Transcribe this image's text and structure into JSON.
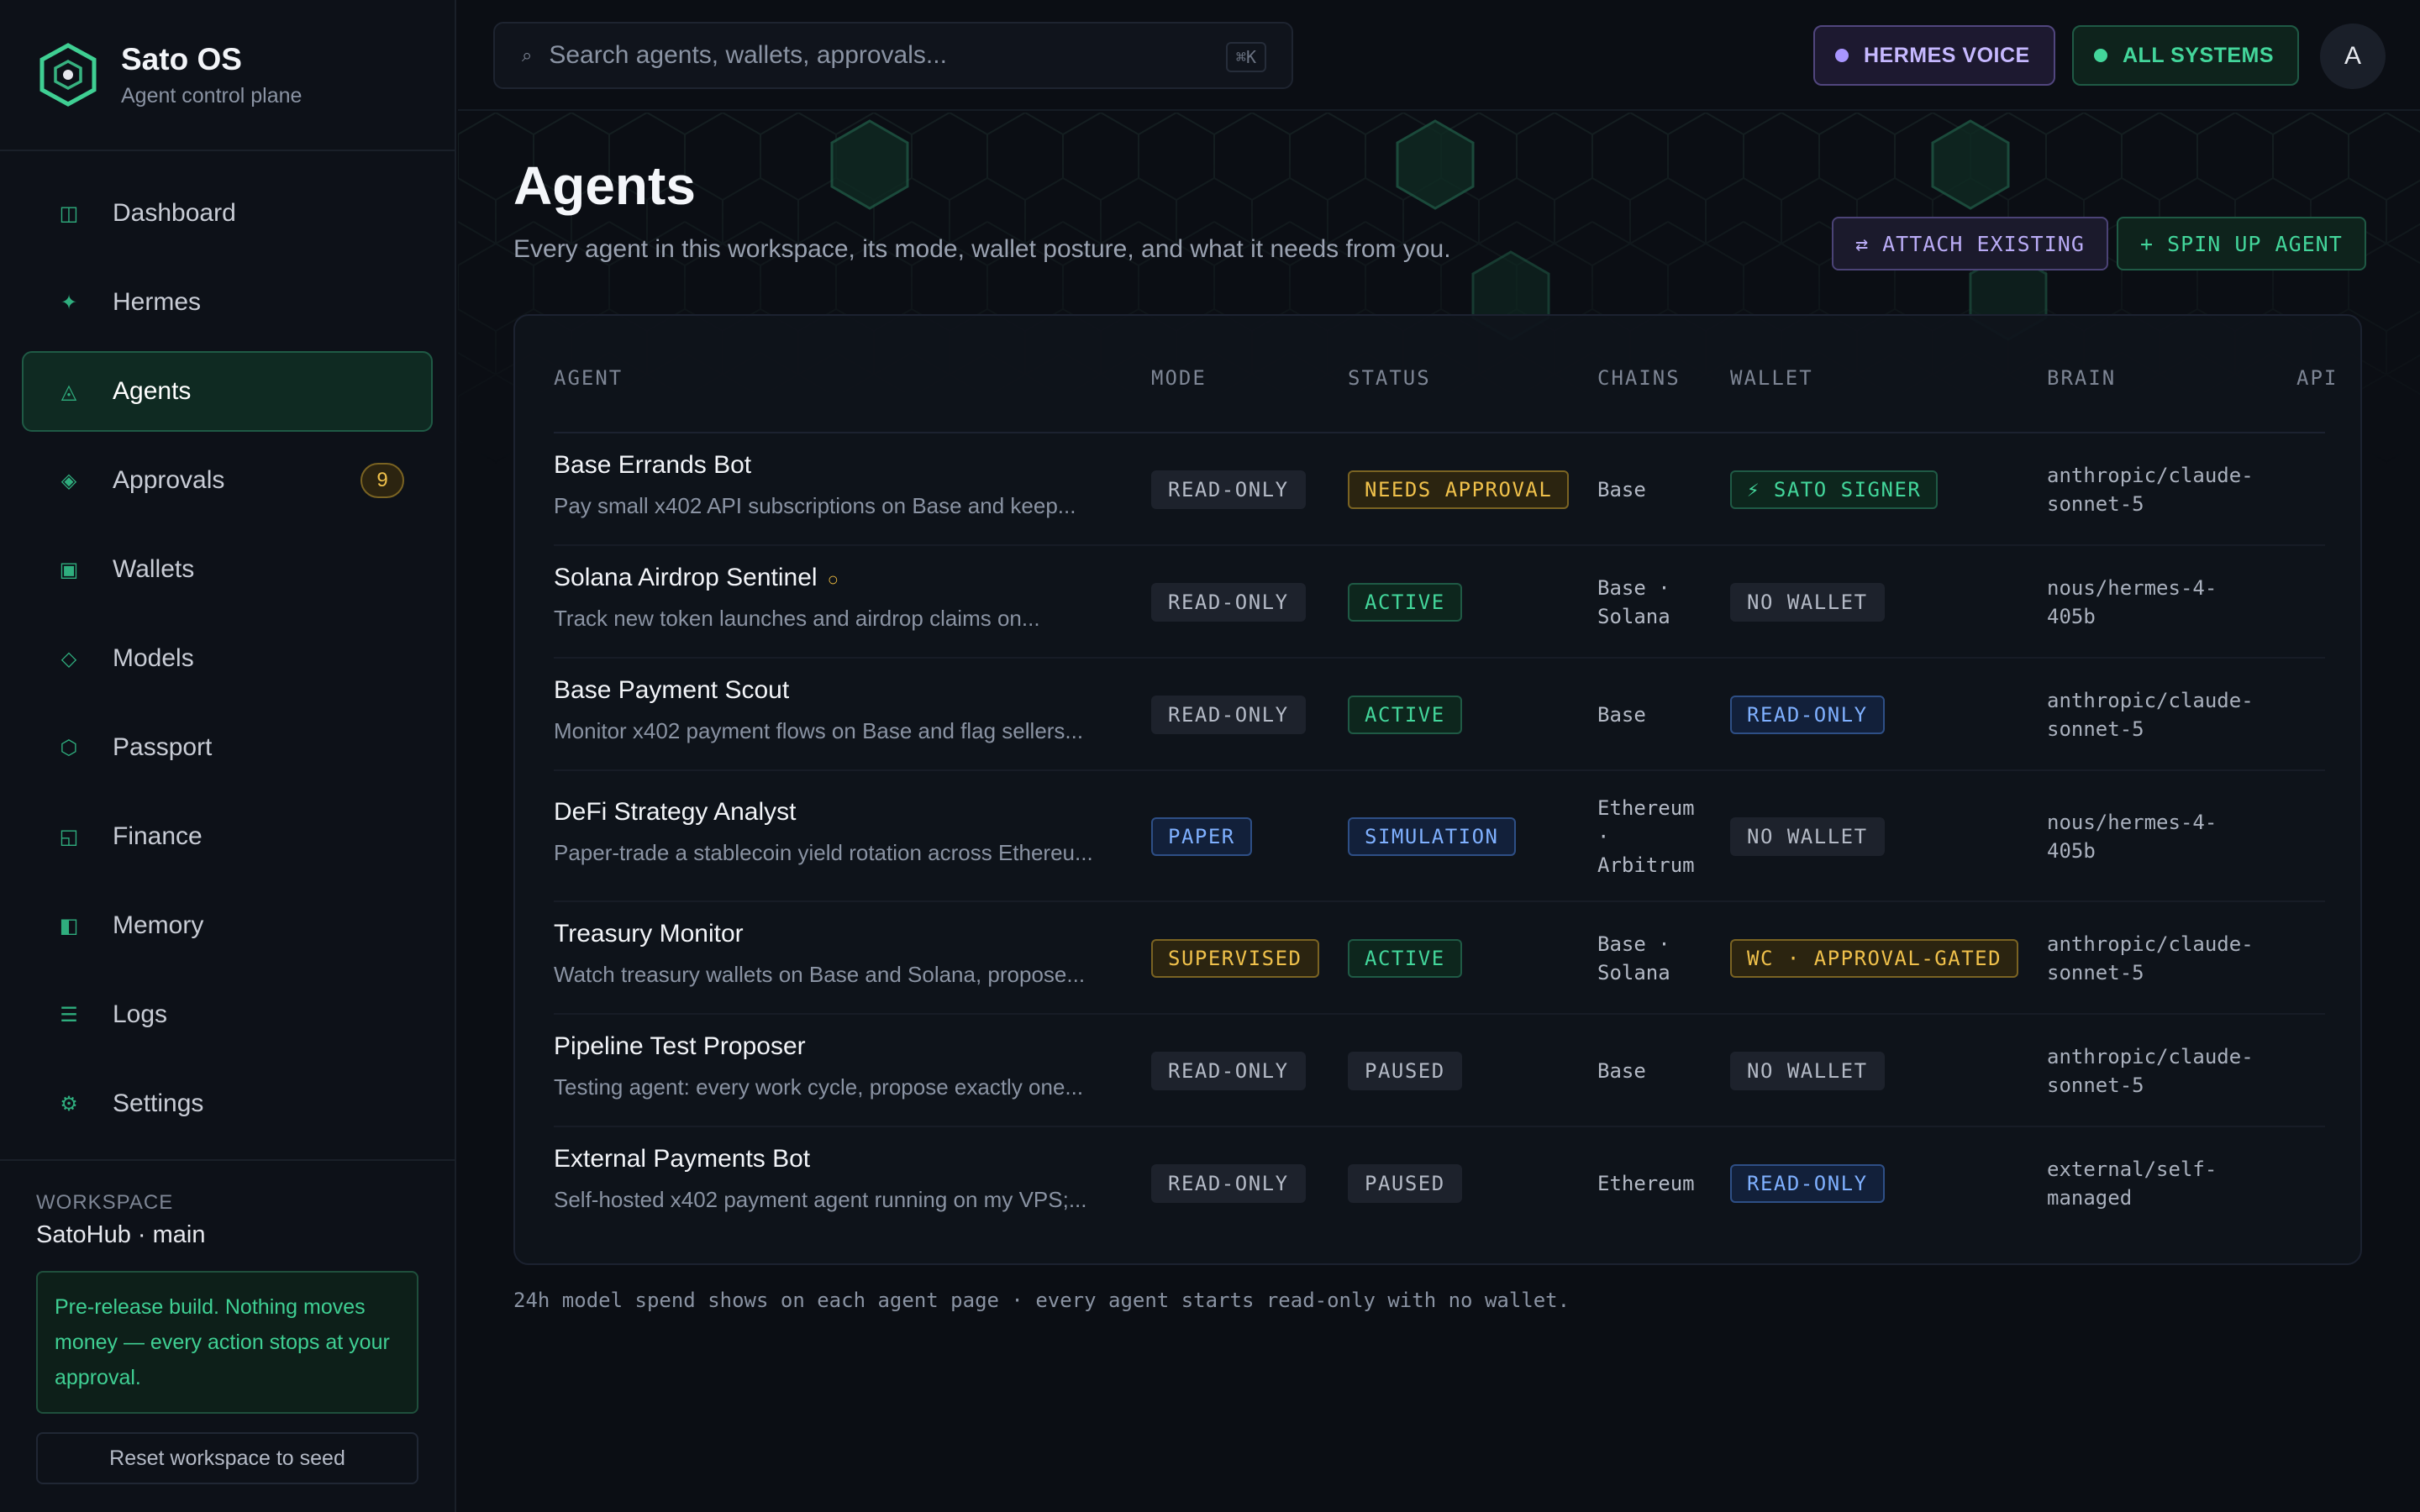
{
  "app": {
    "title": "Sato OS",
    "subtitle": "Agent control plane"
  },
  "nav": [
    {
      "label": "Dashboard",
      "icon": "dashboard-icon",
      "glyph": "◫"
    },
    {
      "label": "Hermes",
      "icon": "sparkle-icon",
      "glyph": "✦"
    },
    {
      "label": "Agents",
      "icon": "agents-icon",
      "glyph": "◬",
      "active": true
    },
    {
      "label": "Approvals",
      "icon": "approvals-icon",
      "glyph": "◈",
      "badge": "9"
    },
    {
      "label": "Wallets",
      "icon": "wallet-icon",
      "glyph": "▣"
    },
    {
      "label": "Models",
      "icon": "models-icon",
      "glyph": "◇"
    },
    {
      "label": "Passport",
      "icon": "passport-icon",
      "glyph": "⬡"
    },
    {
      "label": "Finance",
      "icon": "finance-icon",
      "glyph": "◱"
    },
    {
      "label": "Memory",
      "icon": "memory-icon",
      "glyph": "◧"
    },
    {
      "label": "Logs",
      "icon": "logs-icon",
      "glyph": "☰"
    },
    {
      "label": "Settings",
      "icon": "settings-icon",
      "glyph": "⚙"
    }
  ],
  "workspace": {
    "label": "WORKSPACE",
    "value": "SatoHub · main",
    "note": "Pre-release build. Nothing moves money — every action stops at your approval.",
    "reset_label": "Reset workspace to seed"
  },
  "topbar": {
    "search_placeholder": "Search agents, wallets, approvals...",
    "search_shortcut": "⌘K",
    "voice_label": "HERMES VOICE",
    "systems_label": "ALL SYSTEMS",
    "avatar_initial": "A"
  },
  "page": {
    "title": "Agents",
    "subtitle": "Every agent in this workspace, its mode, wallet posture, and what it needs from you.",
    "attach_label": "⇄ ATTACH EXISTING",
    "spin_label": "+ SPIN UP AGENT"
  },
  "table": {
    "columns": [
      "AGENT",
      "MODE",
      "STATUS",
      "CHAINS",
      "WALLET",
      "BRAIN",
      "API"
    ],
    "rows": [
      {
        "name": "Base Errands Bot",
        "desc": "Pay small x402 API subscriptions on Base and keep...",
        "mode": "READ-ONLY",
        "mode_style": "gray",
        "status": "NEEDS APPROVAL",
        "status_style": "amber",
        "chains": [
          "Base"
        ],
        "wallet": "⚡ SATO SIGNER",
        "wallet_style": "green",
        "brain": [
          "anthropic/claude-",
          "sonnet-5"
        ]
      },
      {
        "name": "Solana Airdrop Sentinel",
        "flag": "○",
        "desc": "Track new token launches and airdrop claims on...",
        "mode": "READ-ONLY",
        "mode_style": "gray",
        "status": "ACTIVE",
        "status_style": "green",
        "chains": [
          "Base ·",
          "Solana"
        ],
        "wallet": "NO WALLET",
        "wallet_style": "gray",
        "brain": [
          "nous/hermes-4-",
          "405b"
        ]
      },
      {
        "name": "Base Payment Scout",
        "desc": "Monitor x402 payment flows on Base and flag sellers...",
        "mode": "READ-ONLY",
        "mode_style": "gray",
        "status": "ACTIVE",
        "status_style": "green",
        "chains": [
          "Base"
        ],
        "wallet": "READ-ONLY",
        "wallet_style": "blue",
        "brain": [
          "anthropic/claude-",
          "sonnet-5"
        ]
      },
      {
        "name": "DeFi Strategy Analyst",
        "desc": "Paper-trade a stablecoin yield rotation across Ethereu...",
        "mode": "PAPER",
        "mode_style": "blue",
        "status": "SIMULATION",
        "status_style": "blue",
        "chains": [
          "Ethereum",
          "·",
          "Arbitrum"
        ],
        "wallet": "NO WALLET",
        "wallet_style": "gray",
        "brain": [
          "nous/hermes-4-",
          "405b"
        ]
      },
      {
        "name": "Treasury Monitor",
        "desc": "Watch treasury wallets on Base and Solana, propose...",
        "mode": "SUPERVISED",
        "mode_style": "amber",
        "status": "ACTIVE",
        "status_style": "green",
        "chains": [
          "Base ·",
          "Solana"
        ],
        "wallet": "WC · APPROVAL-GATED",
        "wallet_style": "amber",
        "brain": [
          "anthropic/claude-",
          "sonnet-5"
        ]
      },
      {
        "name": "Pipeline Test Proposer",
        "desc": "Testing agent: every work cycle, propose exactly one...",
        "mode": "READ-ONLY",
        "mode_style": "gray",
        "status": "PAUSED",
        "status_style": "gray",
        "chains": [
          "Base"
        ],
        "wallet": "NO WALLET",
        "wallet_style": "gray",
        "brain": [
          "anthropic/claude-",
          "sonnet-5"
        ]
      },
      {
        "name": "External Payments Bot",
        "desc": "Self-hosted x402 payment agent running on my VPS;...",
        "mode": "READ-ONLY",
        "mode_style": "gray",
        "status": "PAUSED",
        "status_style": "gray",
        "chains": [
          "Ethereum"
        ],
        "wallet": "READ-ONLY",
        "wallet_style": "blue",
        "brain": [
          "external/self-",
          "managed"
        ]
      }
    ]
  },
  "footnote": "24h model spend shows on each agent page · every agent starts read-only with no wallet.",
  "colors": {
    "accent": "#43d69b",
    "amber": "#f0c14b",
    "blue": "#7fb0ff",
    "violet": "#a996ff",
    "background": "#0b0e14"
  }
}
